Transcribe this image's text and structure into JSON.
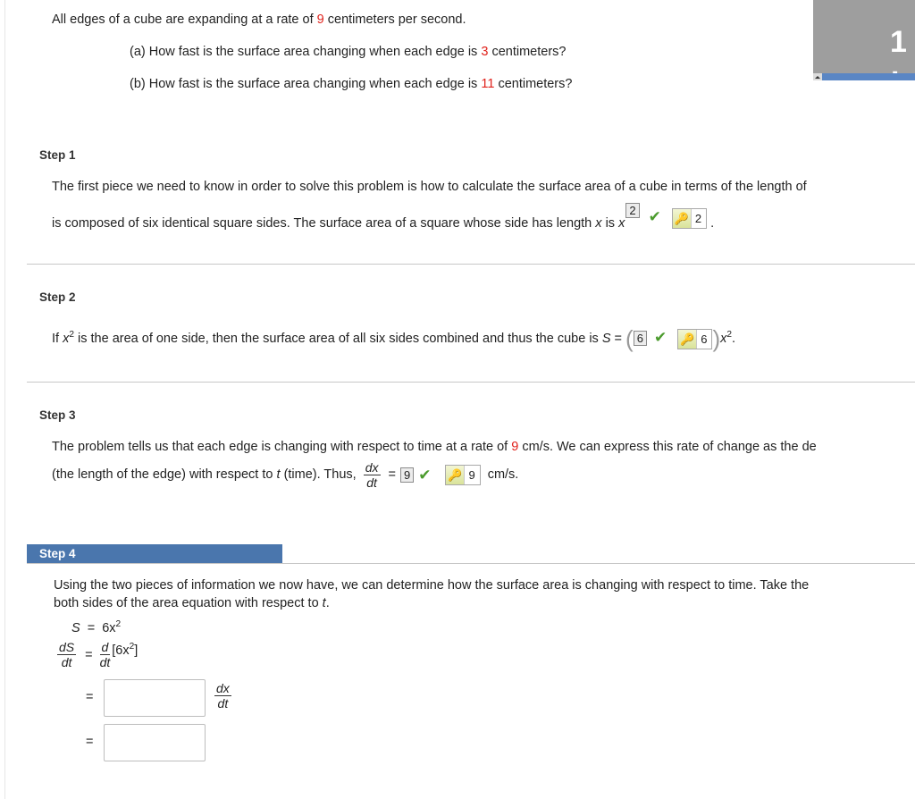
{
  "problem": {
    "line1_pre": "All edges of a cube are expanding at a rate of",
    "line1_rate": "9",
    "line1_post": "centimeters per second.",
    "a_pre": "(a) How fast is the surface area changing when each edge is",
    "a_val": "3",
    "a_post": "centimeters?",
    "b_pre": "(b) How fast is the surface area changing when each edge is",
    "b_val": "11",
    "b_post": "centimeters?"
  },
  "timer": {
    "text": "1 :"
  },
  "step1": {
    "label": "Step 1",
    "line1": "The first piece we need to know in order to solve this problem is how to calculate the surface area of a cube in terms of the length of",
    "line2_pre": "is composed of six identical square sides. The surface area of a square whose side has length",
    "var_x": "x",
    "is": "is",
    "answer": "2",
    "key_answer": "2",
    "period": "."
  },
  "step2": {
    "label": "Step 2",
    "text_pre": "If",
    "var_x": "x",
    "exp": "2",
    "text_mid": "is the area of one side, then the surface area of all six sides combined and thus the cube is",
    "var_S": "S",
    "eq": "=",
    "answer": "6",
    "key_answer": "6",
    "suffix_var": "x",
    "suffix_exp": "2",
    "period": "."
  },
  "step3": {
    "label": "Step 3",
    "line1_pre": "The problem tells us that each edge is changing with respect to time at a rate of",
    "line1_rate": "9",
    "line1_post": "cm/s. We can express this rate of change as the de",
    "line2_pre": "(the length of the edge) with respect to",
    "var_t": "t",
    "line2_mid": "(time). Thus,",
    "frac_num": "dx",
    "frac_den": "dt",
    "eq": "=",
    "answer": "9",
    "key_answer": "9",
    "unit": "cm/s."
  },
  "step4": {
    "label": "Step 4",
    "line1": "Using the two pieces of information we now have, we can determine how the surface area is changing with respect to time. Take the",
    "line2_pre": "both sides of the area equation with respect to",
    "var_t": "t",
    "period": ".",
    "eq1_lhs": "S",
    "eq1_eq": "=",
    "eq1_rhs": "6x",
    "eq1_exp": "2",
    "eq2_lhs_num": "dS",
    "eq2_lhs_den": "dt",
    "eq2_eq": "=",
    "eq2_op_num": "d",
    "eq2_op_den": "dt",
    "eq2_body_pre": "[6x",
    "eq2_body_exp": "2",
    "eq2_body_post": "]",
    "eq3_eq": "=",
    "eq3_frac_num": "dx",
    "eq3_frac_den": "dt",
    "eq4_eq": "=",
    "input1_value": "",
    "input2_value": ""
  }
}
